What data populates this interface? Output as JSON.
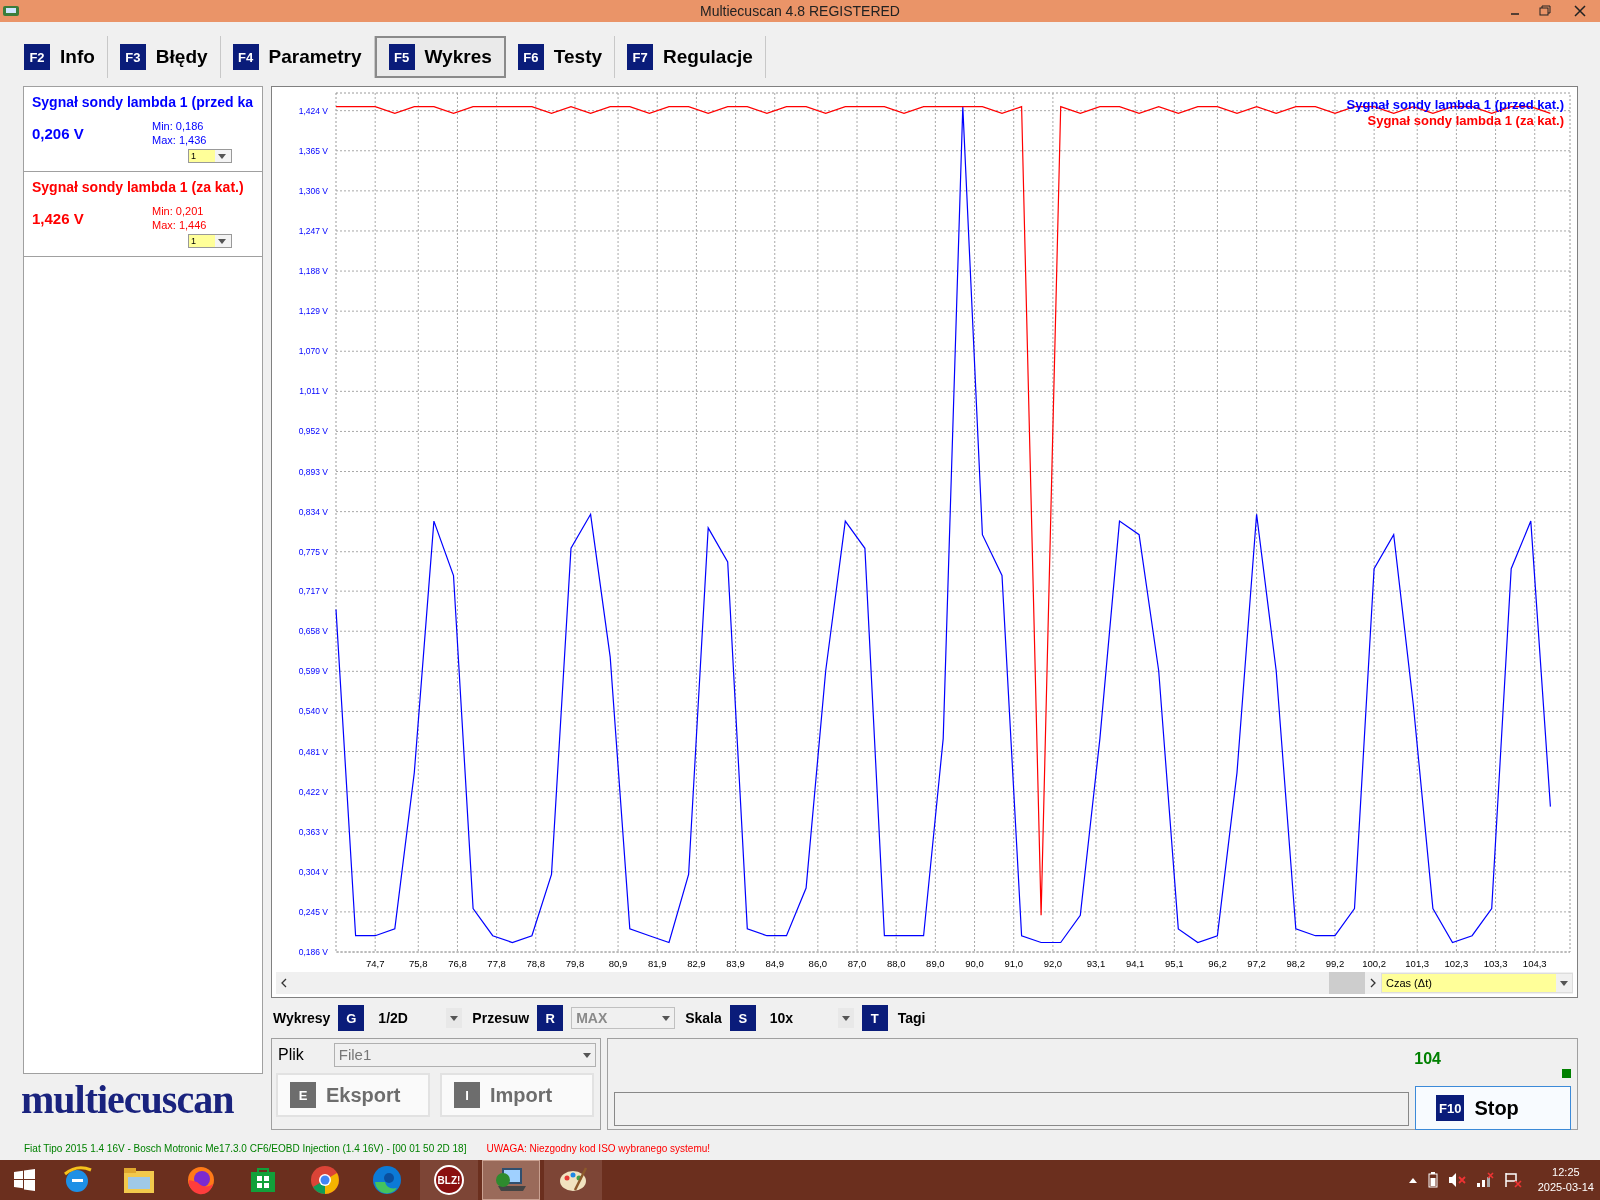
{
  "window": {
    "title": "Multiecuscan 4.8 REGISTERED"
  },
  "tabs": [
    {
      "key": "F2",
      "label": "Info",
      "selected": false
    },
    {
      "key": "F3",
      "label": "Błędy",
      "selected": false
    },
    {
      "key": "F4",
      "label": "Parametry",
      "selected": false
    },
    {
      "key": "F5",
      "label": "Wykres",
      "selected": true
    },
    {
      "key": "F6",
      "label": "Testy",
      "selected": false
    },
    {
      "key": "F7",
      "label": "Regulacje",
      "selected": false
    }
  ],
  "signals": [
    {
      "name": "Sygnał sondy lambda 1 (przed ka",
      "value": "0,206 V",
      "min": "Min: 0,186",
      "max": "Max: 1,436",
      "selector": "1",
      "color": "#0000ff"
    },
    {
      "name": "Sygnał sondy lambda 1 (za kat.)",
      "value": "1,426 V",
      "min": "Min: 0,201",
      "max": "Max: 1,446",
      "selector": "1",
      "color": "#ff0000"
    }
  ],
  "chart": {
    "time_axis": "Czas (Δt)",
    "chart_data": {
      "type": "line",
      "grid": true,
      "xlim": [
        73.7,
        105.2
      ],
      "ylim": [
        0.186,
        1.45
      ],
      "x": [
        73.7,
        74.2,
        74.7,
        75.2,
        75.7,
        76.2,
        76.7,
        77.2,
        77.7,
        78.2,
        78.7,
        79.2,
        79.7,
        80.2,
        80.7,
        81.2,
        81.7,
        82.2,
        82.7,
        83.2,
        83.7,
        84.2,
        84.7,
        85.2,
        85.7,
        86.2,
        86.7,
        87.2,
        87.7,
        88.2,
        88.7,
        89.2,
        89.7,
        90.2,
        90.7,
        91.2,
        91.7,
        92.2,
        92.7,
        93.2,
        93.7,
        94.2,
        94.7,
        95.2,
        95.7,
        96.2,
        96.7,
        97.2,
        97.7,
        98.2,
        98.7,
        99.2,
        99.7,
        100.2,
        100.7,
        101.2,
        101.7,
        102.2,
        102.7,
        103.2,
        103.7,
        104.2,
        104.7
      ],
      "series": [
        {
          "name": "Sygnał sondy lambda 1 (przed kat.)",
          "color": "#0000ff",
          "values": [
            0.69,
            0.21,
            0.21,
            0.22,
            0.45,
            0.82,
            0.74,
            0.25,
            0.21,
            0.2,
            0.21,
            0.3,
            0.78,
            0.83,
            0.62,
            0.22,
            0.21,
            0.2,
            0.3,
            0.81,
            0.76,
            0.22,
            0.21,
            0.21,
            0.28,
            0.6,
            0.82,
            0.78,
            0.21,
            0.21,
            0.21,
            0.5,
            1.43,
            0.8,
            0.74,
            0.21,
            0.2,
            0.2,
            0.24,
            0.5,
            0.82,
            0.8,
            0.6,
            0.22,
            0.2,
            0.21,
            0.45,
            0.83,
            0.6,
            0.22,
            0.21,
            0.21,
            0.25,
            0.75,
            0.8,
            0.55,
            0.25,
            0.2,
            0.21,
            0.25,
            0.75,
            0.82,
            0.4
          ]
        },
        {
          "name": "Sygnał sondy lambda 1 (za kat.)",
          "color": "#ff0000",
          "values": [
            1.43,
            1.43,
            1.43,
            1.42,
            1.43,
            1.43,
            1.42,
            1.43,
            1.43,
            1.43,
            1.43,
            1.42,
            1.43,
            1.42,
            1.43,
            1.43,
            1.42,
            1.43,
            1.43,
            1.42,
            1.43,
            1.43,
            1.42,
            1.43,
            1.43,
            1.42,
            1.43,
            1.43,
            1.43,
            1.42,
            1.43,
            1.43,
            1.43,
            1.43,
            1.42,
            1.43,
            0.24,
            1.43,
            1.42,
            1.43,
            1.43,
            1.42,
            1.43,
            1.42,
            1.43,
            1.43,
            1.42,
            1.43,
            1.42,
            1.43,
            1.43,
            1.42,
            1.43,
            1.43,
            1.42,
            1.43,
            1.42,
            1.43,
            1.43,
            1.42,
            1.43,
            1.43,
            1.42
          ]
        }
      ],
      "xticks": [
        {
          "value": 74.7,
          "label": "74,7"
        },
        {
          "value": 75.8,
          "label": "75,8"
        },
        {
          "value": 76.8,
          "label": "76,8"
        },
        {
          "value": 77.8,
          "label": "77,8"
        },
        {
          "value": 78.8,
          "label": "78,8"
        },
        {
          "value": 79.8,
          "label": "79,8"
        },
        {
          "value": 80.9,
          "label": "80,9"
        },
        {
          "value": 81.9,
          "label": "81,9"
        },
        {
          "value": 82.9,
          "label": "82,9"
        },
        {
          "value": 83.9,
          "label": "83,9"
        },
        {
          "value": 84.9,
          "label": "84,9"
        },
        {
          "value": 86.0,
          "label": "86,0"
        },
        {
          "value": 87.0,
          "label": "87,0"
        },
        {
          "value": 88.0,
          "label": "88,0"
        },
        {
          "value": 89.0,
          "label": "89,0"
        },
        {
          "value": 90.0,
          "label": "90,0"
        },
        {
          "value": 91.0,
          "label": "91,0"
        },
        {
          "value": 92.0,
          "label": "92,0"
        },
        {
          "value": 93.1,
          "label": "93,1"
        },
        {
          "value": 94.1,
          "label": "94,1"
        },
        {
          "value": 95.1,
          "label": "95,1"
        },
        {
          "value": 96.2,
          "label": "96,2"
        },
        {
          "value": 97.2,
          "label": "97,2"
        },
        {
          "value": 98.2,
          "label": "98,2"
        },
        {
          "value": 99.2,
          "label": "99,2"
        },
        {
          "value": 100.2,
          "label": "100,2"
        },
        {
          "value": 101.3,
          "label": "101,3"
        },
        {
          "value": 102.3,
          "label": "102,3"
        },
        {
          "value": 103.3,
          "label": "103,3"
        },
        {
          "value": 104.3,
          "label": "104,3"
        }
      ],
      "yticks": [
        {
          "value": 0.186,
          "label": "0,186 V"
        },
        {
          "value": 0.245,
          "label": "0,245 V"
        },
        {
          "value": 0.304,
          "label": "0,304 V"
        },
        {
          "value": 0.363,
          "label": "0,363 V"
        },
        {
          "value": 0.422,
          "label": "0,422 V"
        },
        {
          "value": 0.481,
          "label": "0,481 V"
        },
        {
          "value": 0.54,
          "label": "0,540 V"
        },
        {
          "value": 0.599,
          "label": "0,599 V"
        },
        {
          "value": 0.658,
          "label": "0,658 V"
        },
        {
          "value": 0.717,
          "label": "0,717 V"
        },
        {
          "value": 0.775,
          "label": "0,775 V"
        },
        {
          "value": 0.834,
          "label": "0,834 V"
        },
        {
          "value": 0.893,
          "label": "0,893 V"
        },
        {
          "value": 0.952,
          "label": "0,952 V"
        },
        {
          "value": 1.011,
          "label": "1,011 V"
        },
        {
          "value": 1.07,
          "label": "1,070 V"
        },
        {
          "value": 1.129,
          "label": "1,129 V"
        },
        {
          "value": 1.188,
          "label": "1,188 V"
        },
        {
          "value": 1.247,
          "label": "1,247 V"
        },
        {
          "value": 1.306,
          "label": "1,306 V"
        },
        {
          "value": 1.365,
          "label": "1,365 V"
        },
        {
          "value": 1.424,
          "label": "1,424 V"
        }
      ]
    }
  },
  "controls": [
    {
      "kind": "label",
      "text": "Wykresy"
    },
    {
      "kind": "key",
      "text": "G"
    },
    {
      "kind": "dropdown",
      "text": "1/2D",
      "disabled": false
    },
    {
      "kind": "label",
      "text": "Przesuw"
    },
    {
      "kind": "key",
      "text": "R"
    },
    {
      "kind": "dropdown",
      "text": "MAX",
      "disabled": true
    },
    {
      "kind": "label",
      "text": "Skala"
    },
    {
      "kind": "key",
      "text": "S"
    },
    {
      "kind": "dropdown",
      "text": "10x",
      "disabled": false
    },
    {
      "kind": "key",
      "text": "T"
    },
    {
      "kind": "label",
      "text": "Tagi"
    }
  ],
  "file": {
    "label": "Plik",
    "value": "File1",
    "disabled": true
  },
  "file_buttons": [
    {
      "key": "E",
      "label": "Eksport",
      "disabled": true
    },
    {
      "key": "I",
      "label": "Import",
      "disabled": true
    }
  ],
  "counter": "104",
  "stop_button": {
    "key": "F10",
    "label": "Stop"
  },
  "logo": "multiecuscan",
  "status_bar": [
    {
      "text": "Fiat Tipo 2015 1.4 16V - Bosch Motronic Me17.3.0 CF6/EOBD Injection (1.4 16V) - [00 01 50 2D 18]",
      "color": "#008000"
    },
    {
      "text": "UWAGA: Niezgodny kod ISO wybranego systemu!",
      "color": "#ff0000"
    }
  ],
  "taskbar": {
    "apps": [
      {
        "kind": "ie",
        "selected": false
      },
      {
        "kind": "folder",
        "selected": false
      },
      {
        "kind": "firefox",
        "selected": false
      },
      {
        "kind": "store",
        "selected": false
      },
      {
        "kind": "chrome",
        "selected": false
      },
      {
        "kind": "edge",
        "selected": false
      },
      {
        "kind": "blz",
        "label": "BLZ!",
        "selected": false
      },
      {
        "kind": "ecu",
        "selected": true
      },
      {
        "kind": "paint",
        "selected": false
      }
    ],
    "time": "12:25",
    "date": "2025-03-14"
  }
}
